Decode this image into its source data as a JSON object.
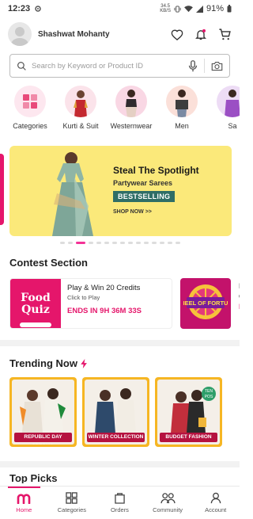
{
  "status_bar": {
    "time": "12:23",
    "network_speed": "34.5",
    "network_unit": "KB/S",
    "battery": "91%"
  },
  "header": {
    "username": "Shashwat Mohanty"
  },
  "search": {
    "placeholder": "Search by Keyword or Product ID"
  },
  "categories": [
    {
      "label": "Categories"
    },
    {
      "label": "Kurti & Suit"
    },
    {
      "label": "Westernwear"
    },
    {
      "label": "Men"
    },
    {
      "label": "Sa"
    }
  ],
  "banner": {
    "title": "Steal The Spotlight",
    "subtitle": "Partywear Sarees",
    "tag": "BESTSELLING",
    "cta": "SHOP NOW >>",
    "slides_total": 15,
    "active_slide": 2
  },
  "contest": {
    "section_title": "Contest Section",
    "card": {
      "thumb_text": "Food Quiz",
      "title": "Play & Win 20 Credits",
      "subtitle": "Click to Play",
      "ends": "ENDS IN 9H 36M 33S"
    },
    "second_thumb_text": "WHEEL OF FORTUNE",
    "peek_letters": [
      "P",
      "C",
      "E"
    ]
  },
  "trending": {
    "title": "Trending Now",
    "cards": [
      {
        "caption": "REPUBLIC DAY SPECIAL"
      },
      {
        "caption": "WINTER COLLECTION"
      },
      {
        "caption": "BUDGET FASHION",
        "badge": "TEN POS"
      }
    ]
  },
  "next_section_title": "Top Picks",
  "bottom_nav": [
    {
      "label": "Home",
      "icon": "meesho-home-icon"
    },
    {
      "label": "Categories",
      "icon": "grid-icon"
    },
    {
      "label": "Orders",
      "icon": "bag-icon"
    },
    {
      "label": "Community",
      "icon": "people-icon"
    },
    {
      "label": "Account",
      "icon": "person-icon"
    }
  ],
  "colors": {
    "brand": "#e5166b",
    "banner_bg": "#fbe97a",
    "tag_bg": "#2f6e66",
    "trending_frame": "#f6b623"
  }
}
